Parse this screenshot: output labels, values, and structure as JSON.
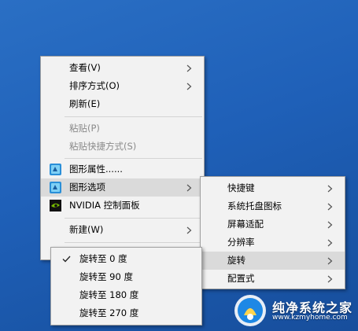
{
  "desktop_menu": {
    "view": "查看(V)",
    "sort": "排序方式(O)",
    "refresh": "刷新(E)",
    "paste": "粘贴(P)",
    "paste_shortcut": "粘贴快捷方式(S)",
    "graphics_properties": "图形属性......",
    "graphics_options": "图形选项",
    "nvidia": "NVIDIA 控制面板",
    "new": "新建(W)"
  },
  "graphics_submenu": {
    "hotkeys": "快捷键",
    "tray_icon": "系统托盘图标",
    "screen_fit": "屏幕适配",
    "resolution": "分辨率",
    "rotation": "旋转",
    "profiles": "配置式"
  },
  "rotation_submenu": {
    "rotate_0": "旋转至 0 度",
    "rotate_90": "旋转至 90 度",
    "rotate_180": "旋转至 180 度",
    "rotate_270": "旋转至 270 度",
    "selected": "rotate_0"
  },
  "watermark": {
    "title": "纯净系统之家",
    "url": "www.kzmyhome.com"
  }
}
